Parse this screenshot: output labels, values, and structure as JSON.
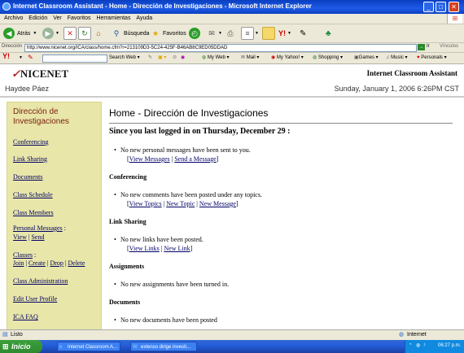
{
  "window": {
    "title": "Internet Classroom Assistant - Home - Dirección de Investigaciones - Microsoft Internet Explorer"
  },
  "menu": [
    "Archivo",
    "Edición",
    "Ver",
    "Favoritos",
    "Herramientas",
    "Ayuda"
  ],
  "toolbar": {
    "back": "Atrás",
    "search": "Búsqueda",
    "favorites": "Favoritos"
  },
  "address": {
    "label": "Dirección",
    "url": "http://www.nicenet.org/ICA/class/home.cfm?r=213109D3-5C24-425F-B46AB8C9ED05DDAD",
    "go_glyph": "→",
    "go_label": "Ir",
    "links_label": "Vínculos"
  },
  "yahoo_bar": {
    "brand": "Y!",
    "search_label": "Search Web",
    "my_web": "My Web",
    "mail": "Mail",
    "my_yahoo": "My Yahoo!",
    "shopping": "Shopping",
    "games": "Games",
    "music": "Music",
    "personals": "Personals"
  },
  "site": {
    "logo": "NICENET",
    "title": "Internet Classroom Assistant",
    "user": "Haydee Páez",
    "date": "Sunday, January 1, 2006 6:26PM CST"
  },
  "sidebar": {
    "heading": "Dirección de Investigaciones",
    "conferencing": "Conferencing",
    "link_sharing": "Link Sharing",
    "documents": "Documents",
    "class_schedule": "Class Schedule",
    "class_members": "Class Members",
    "personal_messages": "Personal Messages",
    "pm_colon": ":",
    "view": "View",
    "send": "Send",
    "sep": "|",
    "classes": "Classes",
    "classes_colon": ":",
    "join": "Join",
    "create": "Create",
    "drop": "Drop",
    "delete": "Delete",
    "class_admin": "Class Administration",
    "edit_profile": "Edit User Profile",
    "faq": "ICA FAQ"
  },
  "main": {
    "title": "Home - Dirección de Investigaciones",
    "welcome": "Since you last logged in on Thursday, December 29 :",
    "messages_text": "No new personal messages have been sent to you.",
    "view_messages": "View Messages",
    "send_message": "Send a Message",
    "conferencing_heading": "Conferencing",
    "conferencing_text": "No new comments have been posted under any topics.",
    "view_topics": "View Topics",
    "new_topic": "New Topic",
    "new_message": "New Message",
    "link_sharing_heading": "Link Sharing",
    "links_text": "No new links have been posted.",
    "view_links": "View Links",
    "new_link": "New Link",
    "assignments_heading": "Assignments",
    "assignments_text": "No new assignments have been turned in.",
    "documents_heading": "Documents",
    "documents_text": "No new documents have been posted",
    "lb": "[",
    "rb": "]",
    "sep": "|"
  },
  "status": {
    "left": "Listo",
    "zone": "Internet"
  },
  "taskbar": {
    "start": "Inicio",
    "task1": "Internet Classroom A...",
    "task2": "extenso dirige investi...",
    "clock": "06:27 p.m."
  }
}
